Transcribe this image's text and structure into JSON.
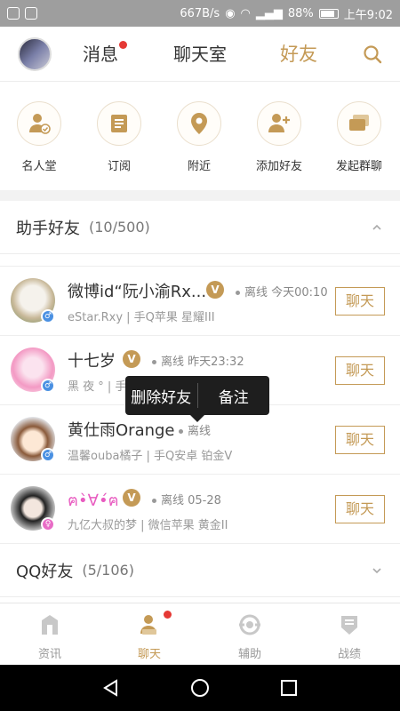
{
  "status_bar": {
    "speed": "667B/s",
    "battery": "88%",
    "time": "上午9:02"
  },
  "topnav": {
    "tabs": [
      {
        "label": "消息"
      },
      {
        "label": "聊天室"
      },
      {
        "label": "好友"
      }
    ],
    "active_tab": "好友"
  },
  "actions": [
    {
      "label": "名人堂",
      "icon": "hall-of-fame-icon"
    },
    {
      "label": "订阅",
      "icon": "subscribe-icon"
    },
    {
      "label": "附近",
      "icon": "location-pin-icon"
    },
    {
      "label": "添加好友",
      "icon": "add-friend-icon"
    },
    {
      "label": "发起群聊",
      "icon": "group-chat-icon"
    }
  ],
  "assistant_group": {
    "title": "助手好友",
    "count": "(10/500)",
    "friends": [
      {
        "name": "微博id“阮小渝Rx...",
        "verified": "V",
        "status": "离线 今天00:10",
        "sub": "eStar.Rxy | 手Q苹果 星耀III",
        "chat": "聊天",
        "gender": "male"
      },
      {
        "name": "十七岁",
        "verified": "V",
        "status": "离线 昨天23:32",
        "sub": "黑 夜 ° | 手",
        "chat": "聊天",
        "gender": "male"
      },
      {
        "name": "黄仕雨Orange",
        "verified": "",
        "status": "离线",
        "sub": "温馨ouba橘子 | 手Q安卓 铂金V",
        "chat": "聊天",
        "gender": "male"
      },
      {
        "name": "ฅ•̀∀•́ฅ",
        "verified": "V",
        "status": "离线 05-28",
        "sub": "九亿大叔的梦 | 微信苹果 黄金II",
        "chat": "聊天",
        "gender": "female"
      }
    ]
  },
  "popup_menu": {
    "delete": "删除好友",
    "remark": "备注"
  },
  "qq_group": {
    "title": "QQ好友",
    "count": "(5/106)"
  },
  "bottomnav": [
    {
      "label": "资讯",
      "icon": "news-icon"
    },
    {
      "label": "聊天",
      "icon": "chat-icon"
    },
    {
      "label": "辅助",
      "icon": "assist-icon"
    },
    {
      "label": "战绩",
      "icon": "record-icon"
    }
  ],
  "colors": {
    "accent": "#c49a56",
    "badge_red": "#e53935",
    "status_bar": "#9e9e9e"
  }
}
